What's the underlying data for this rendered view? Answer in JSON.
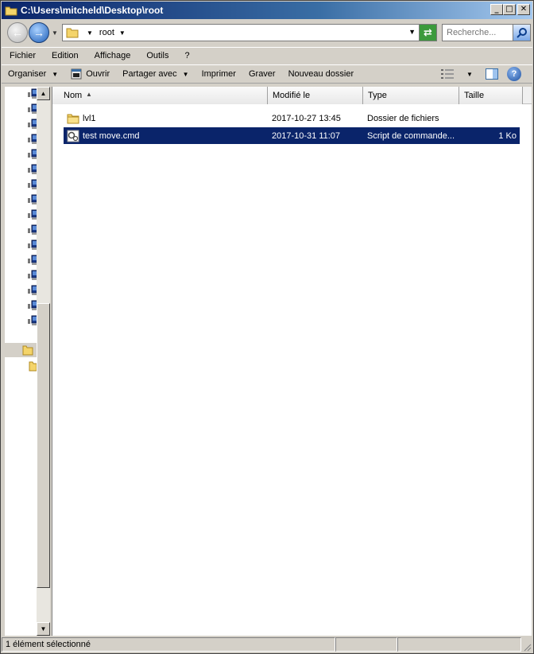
{
  "window": {
    "title": "C:\\Users\\mitcheld\\Desktop\\root",
    "buttons": {
      "minimize": "_",
      "maximize": "□",
      "close": "✕"
    }
  },
  "address": {
    "crumb": "root",
    "search_placeholder": "Recherche..."
  },
  "menu": [
    "Fichier",
    "Edition",
    "Affichage",
    "Outils",
    "?"
  ],
  "toolbar": {
    "organize": "Organiser",
    "open": "Ouvrir",
    "share": "Partager avec",
    "print": "Imprimer",
    "burn": "Graver",
    "new_folder": "Nouveau dossier"
  },
  "columns": {
    "name": "Nom",
    "modified": "Modifié le",
    "type": "Type",
    "size": "Taille"
  },
  "files": [
    {
      "name": "lvl1",
      "modified": "2017-10-27 13:45",
      "type": "Dossier de fichiers",
      "size": "",
      "icon": "folder-icon",
      "selected": false
    },
    {
      "name": "test move.cmd",
      "modified": "2017-10-31 11:07",
      "type": "Script de commande...",
      "size": "1 Ko",
      "icon": "cmd-script-icon",
      "selected": true
    }
  ],
  "status": {
    "text": "1 élément sélectionné"
  },
  "colors": {
    "selection": "#0a246a",
    "titlebar_start": "#0a246a",
    "face": "#d4d0c8"
  }
}
